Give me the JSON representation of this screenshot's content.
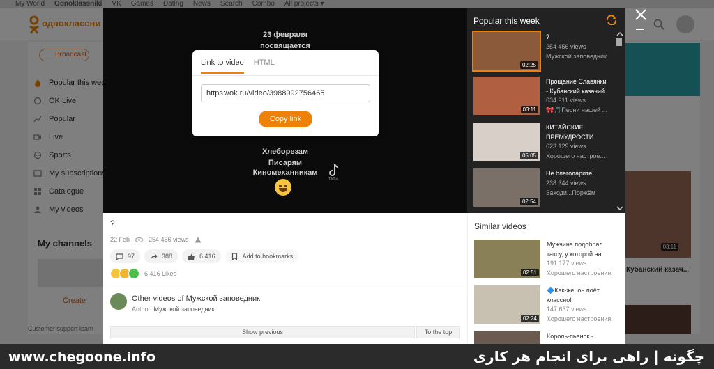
{
  "site": {
    "topbar": [
      "My World",
      "Odnoklassniki",
      "VK",
      "Games",
      "Dating",
      "News",
      "Search",
      "Combo",
      "All projects ▾"
    ],
    "logo_text": "одноклассни",
    "tab_chip": "Broadcast",
    "nav": [
      "Popular this week",
      "OK Live",
      "Popular",
      "Live",
      "Sports",
      "My subscriptions",
      "Catalogue",
      "My videos"
    ],
    "my_channels": "My channels",
    "create": "Create",
    "support": "Customer support   learn",
    "right_caption": "Кубанский казач...",
    "right_duration": "03:11"
  },
  "player": {
    "lines_top": [
      "23 февраля",
      "посвящается"
    ],
    "lines_bottom": [
      "Хлеборезам",
      "Писарям",
      "Киномеханникам"
    ],
    "tiktok_label": "TikTok"
  },
  "link_dialog": {
    "tab_link": "Link to video",
    "tab_html": "HTML",
    "url": "https://ok.ru/video/3988992756465",
    "copy_button": "Copy link"
  },
  "video": {
    "title": "?",
    "date": "22 Feb",
    "views": "254 456 views",
    "comments": "97",
    "shares": "388",
    "likes_count": "6 416",
    "bookmark": "Add to bookmarks",
    "likes_text": "6 416 Likes",
    "other_videos": "Other videos of Мужской заповедник",
    "author_label": "Author:",
    "author_name": "Мужской заповедник",
    "show_previous": "Show previous",
    "to_top": "To the top"
  },
  "popular": {
    "title": "Popular this week",
    "items": [
      {
        "title": "?",
        "title2": "",
        "views": "254 456 views",
        "channel": "Мужской заповедник",
        "duration": "02:25",
        "color": "#8a5a3a"
      },
      {
        "title": "Прощание Славянки",
        "title2": "- Кубанский казачий",
        "views": "634 911 views",
        "channel": "🎀🎵Песни нашей ...",
        "duration": "03:11",
        "color": "#b06040"
      },
      {
        "title": "КИТАЙСКИЕ",
        "title2": "ПРЕМУДРОСТИ",
        "views": "623 129 views",
        "channel": "Хорошего настрое...",
        "duration": "05:05",
        "color": "#d8d0c8"
      },
      {
        "title": "Не благодарите!",
        "title2": "",
        "views": "238 344 views",
        "channel": "Заходи...Поржём",
        "duration": "02:54",
        "color": "#7a7068"
      }
    ]
  },
  "similar": {
    "title": "Similar videos",
    "items": [
      {
        "title": "Мужчина подобрал",
        "title2": "таксу, у которой на",
        "views": "191 177 views",
        "channel": "Хорошего настроения!",
        "duration": "02:51",
        "color": "#8a8058"
      },
      {
        "title": "🔷Как-же, он поёт",
        "title2": "классно!",
        "views": "147 637 views",
        "channel": "Хорошего настроения!",
        "duration": "02:24",
        "color": "#c8c0b0"
      },
      {
        "title": "Король-пьенок -",
        "title2": "",
        "views": "",
        "channel": "",
        "duration": "",
        "color": "#6a5a50"
      }
    ]
  },
  "watermark": {
    "left": "www.chegoone.info",
    "right": "چگونه | راهی برای انجام هر کاری"
  },
  "colors": {
    "accent": "#ee8208"
  }
}
